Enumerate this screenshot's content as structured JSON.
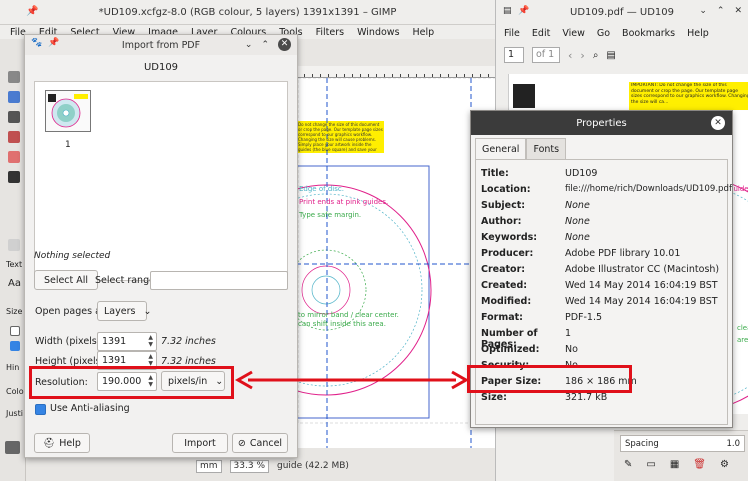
{
  "gimp": {
    "title": "*UD109.xcfgz-8.0 (RGB colour, 5 layers) 1391x1391 – GIMP",
    "menu": [
      "File",
      "Edit",
      "Select",
      "View",
      "Image",
      "Layer",
      "Colours",
      "Tools",
      "Filters",
      "Windows",
      "Help"
    ],
    "status": {
      "unit": "mm",
      "zoom": "33.3 %",
      "info": "guide (42.2 MB)"
    },
    "side_labels": [
      "Text",
      "Aa",
      "Size",
      "Hin",
      "Colo",
      "Justi"
    ]
  },
  "canvas": {
    "notice": "Do not change the size of this document or crop the page. Our template page sizes correspond to our graphics workflow. Changing the size will cause problems. Simply place your artwork inside the guides (the blue square) and save your PDF.",
    "lines": [
      "Edge of disc.",
      "Print ends at pink guides.",
      "Type safe margin.",
      "to mirror band / clear center.",
      "can shift inside this area."
    ]
  },
  "import_dialog": {
    "title": "Import from PDF",
    "doc_name": "UD109",
    "page_number": "1",
    "nothing_selected": "Nothing selected",
    "select_all": "Select All",
    "select_range_label": "Select range:",
    "select_range_value": "",
    "open_pages_as_label": "Open pages as",
    "open_pages_as_value": "Layers",
    "width_label": "Width (pixels):",
    "width_value": "1391",
    "width_inches": "7.32 inches",
    "height_label": "Height (pixels):",
    "height_value": "1391",
    "height_inches": "7.32 inches",
    "resolution_label": "Resolution:",
    "resolution_value": "190.000",
    "resolution_unit": "pixels/in",
    "antialias_label": "Use Anti-aliasing",
    "help_label": "Help",
    "import_label": "Import",
    "cancel_label": "Cancel"
  },
  "viewer": {
    "title": "UD109.pdf — UD109",
    "menu": [
      "File",
      "Edit",
      "View",
      "Go",
      "Bookmarks",
      "Help"
    ],
    "page_current": "1",
    "page_total": "of 1",
    "page_notice": "IMPORTANT: Do not change the size of this document or crop the page. Our template page sizes correspond to our graphics workflow. Changing the size will ca...",
    "right_texts": [
      "k guides.",
      "clear",
      "area."
    ],
    "spacing_label": "Spacing",
    "spacing_value": "1.0"
  },
  "properties": {
    "title": "Properties",
    "tabs": [
      "General",
      "Fonts"
    ],
    "rows": [
      {
        "k": "Title:",
        "v": "UD109"
      },
      {
        "k": "Location:",
        "v": "file:///home/rich/Downloads/UD109.pdf"
      },
      {
        "k": "Subject:",
        "v": "None"
      },
      {
        "k": "Author:",
        "v": "None"
      },
      {
        "k": "Keywords:",
        "v": "None"
      },
      {
        "k": "Producer:",
        "v": "Adobe PDF library 10.01"
      },
      {
        "k": "Creator:",
        "v": "Adobe Illustrator CC (Macintosh)"
      },
      {
        "k": "Created:",
        "v": "Wed 14 May 2014 16:04:19 BST"
      },
      {
        "k": "Modified:",
        "v": "Wed 14 May 2014 16:04:19 BST"
      },
      {
        "k": "Format:",
        "v": "PDF-1.5"
      },
      {
        "k": "Number of Pages:",
        "v": "1"
      },
      {
        "k": "Optimized:",
        "v": "No"
      },
      {
        "k": "Security:",
        "v": "No"
      },
      {
        "k": "Paper Size:",
        "v": "186 × 186 mm"
      },
      {
        "k": "Size:",
        "v": "321.7 kB"
      }
    ]
  },
  "colors": {
    "highlight": "#e0101a",
    "accent": "#3584e4",
    "guide_blue": "#2255cc",
    "pink": "#e0208a",
    "cyan": "#4fb3c8",
    "green": "#3aaa4a"
  }
}
